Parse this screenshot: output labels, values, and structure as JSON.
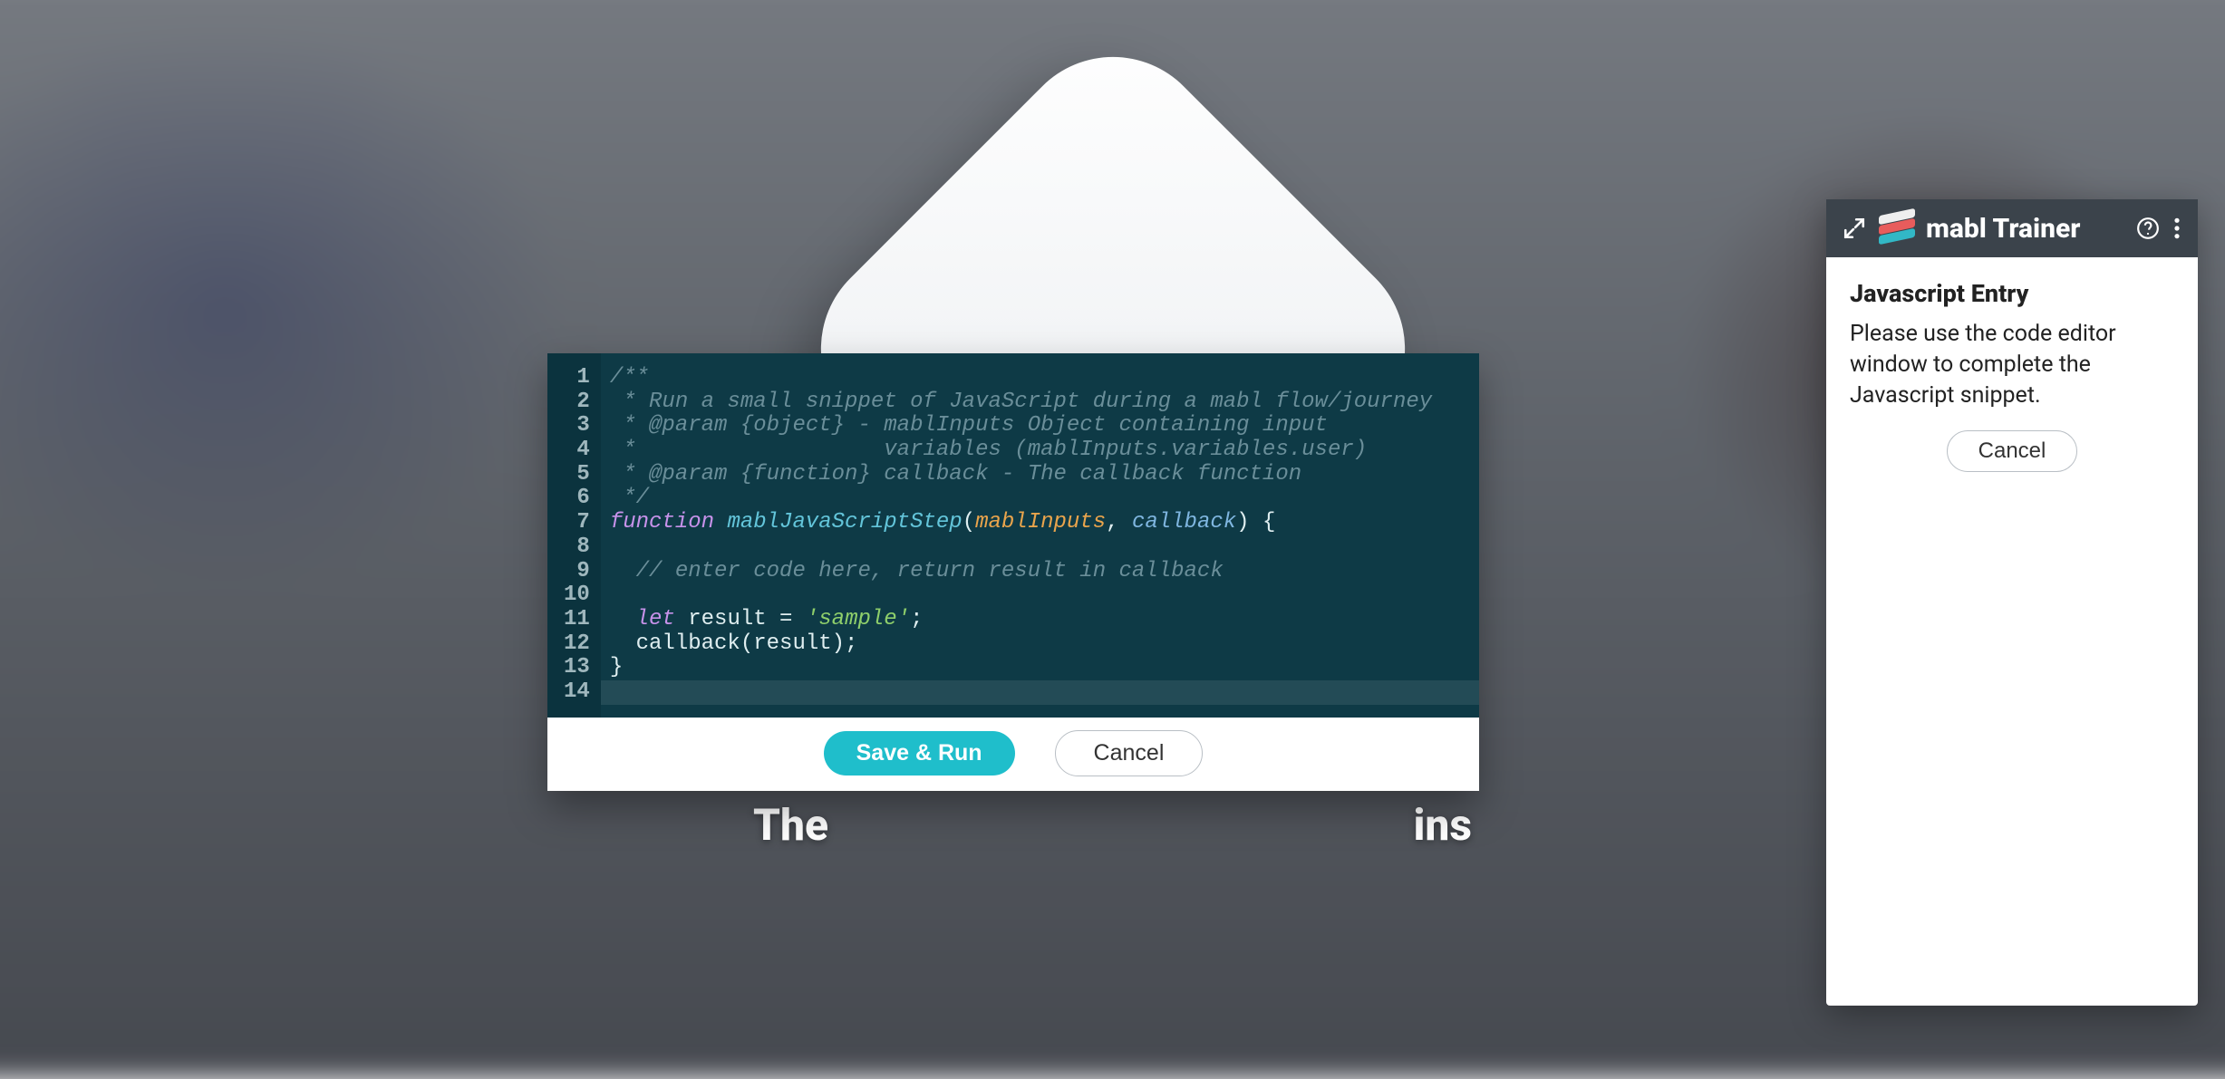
{
  "hero": {
    "text_left": "The",
    "text_right": "ins"
  },
  "editor": {
    "lines": [
      {
        "n": 1,
        "segments": [
          {
            "cls": "tok-comment",
            "t": "/**"
          }
        ]
      },
      {
        "n": 2,
        "segments": [
          {
            "cls": "tok-comment",
            "t": " * Run a small snippet of JavaScript during a mabl flow/journey"
          }
        ]
      },
      {
        "n": 3,
        "segments": [
          {
            "cls": "tok-comment",
            "t": " * @param {object} - mablInputs Object containing input"
          }
        ]
      },
      {
        "n": 4,
        "segments": [
          {
            "cls": "tok-comment",
            "t": " *                   variables (mablInputs.variables.user)"
          }
        ]
      },
      {
        "n": 5,
        "segments": [
          {
            "cls": "tok-comment",
            "t": " * @param {function} callback - The callback function"
          }
        ]
      },
      {
        "n": 6,
        "segments": [
          {
            "cls": "tok-comment",
            "t": " */"
          }
        ]
      },
      {
        "n": 7,
        "segments": [
          {
            "cls": "tok-keyword",
            "t": "function "
          },
          {
            "cls": "tok-func",
            "t": "mablJavaScriptStep"
          },
          {
            "cls": "tok-plain",
            "t": "("
          },
          {
            "cls": "tok-param",
            "t": "mablInputs"
          },
          {
            "cls": "tok-plain",
            "t": ", "
          },
          {
            "cls": "tok-param2",
            "t": "callback"
          },
          {
            "cls": "tok-plain",
            "t": ") {"
          }
        ]
      },
      {
        "n": 8,
        "segments": []
      },
      {
        "n": 9,
        "segments": [
          {
            "cls": "tok-comment",
            "t": "  // enter code here, return result in callback"
          }
        ]
      },
      {
        "n": 10,
        "segments": []
      },
      {
        "n": 11,
        "segments": [
          {
            "cls": "tok-plain",
            "t": "  "
          },
          {
            "cls": "tok-keyword",
            "t": "let "
          },
          {
            "cls": "tok-plain",
            "t": "result = "
          },
          {
            "cls": "tok-string",
            "t": "'sample'"
          },
          {
            "cls": "tok-plain",
            "t": ";"
          }
        ]
      },
      {
        "n": 12,
        "segments": [
          {
            "cls": "tok-plain",
            "t": "  callback(result);"
          }
        ]
      },
      {
        "n": 13,
        "segments": [
          {
            "cls": "tok-plain",
            "t": "}"
          }
        ]
      },
      {
        "n": 14,
        "segments": []
      }
    ],
    "active_line": 14,
    "save_label": "Save & Run",
    "cancel_label": "Cancel"
  },
  "trainer": {
    "title": "mabl Trainer",
    "panel_heading": "Javascript Entry",
    "panel_body": "Please use the code editor window to complete the Javascript snippet.",
    "cancel_label": "Cancel"
  }
}
